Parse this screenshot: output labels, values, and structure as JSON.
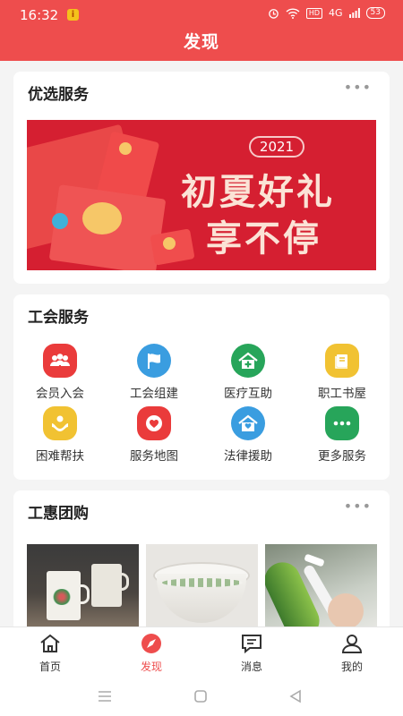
{
  "status": {
    "time": "16:32",
    "notif_badge": "i",
    "network": "4G",
    "hd": "HD",
    "battery": "53"
  },
  "header": {
    "title": "发现"
  },
  "featured": {
    "title": "优选服务",
    "more_icon": "more-dots-icon",
    "banner": {
      "year": "2021",
      "line1": "初夏好礼",
      "line2": "享不停"
    }
  },
  "union": {
    "title": "工会服务",
    "items": [
      {
        "label": "会员入会",
        "icon": "members-icon",
        "color": "#ea3b3b"
      },
      {
        "label": "工会组建",
        "icon": "flag-icon",
        "color": "#3a9de0"
      },
      {
        "label": "医疗互助",
        "icon": "medical-icon",
        "color": "#27a55a"
      },
      {
        "label": "职工书屋",
        "icon": "book-icon",
        "color": "#f1c232"
      },
      {
        "label": "困难帮扶",
        "icon": "help-hands-icon",
        "color": "#f1c232"
      },
      {
        "label": "服务地图",
        "icon": "heart-map-icon",
        "color": "#ea3b3b"
      },
      {
        "label": "法律援助",
        "icon": "law-home-icon",
        "color": "#3a9de0"
      },
      {
        "label": "更多服务",
        "icon": "more-icon",
        "color": "#27a55a"
      }
    ]
  },
  "groupbuy": {
    "title": "工惠团购",
    "more_icon": "more-dots-icon"
  },
  "nav": [
    {
      "label": "首页",
      "icon": "home-icon",
      "active": false
    },
    {
      "label": "发现",
      "icon": "compass-icon",
      "active": true
    },
    {
      "label": "消息",
      "icon": "message-icon",
      "active": false
    },
    {
      "label": "我的",
      "icon": "user-icon",
      "active": false
    }
  ],
  "colors": {
    "brand": "#ee4d4d",
    "accent": "#ee4d4d"
  }
}
